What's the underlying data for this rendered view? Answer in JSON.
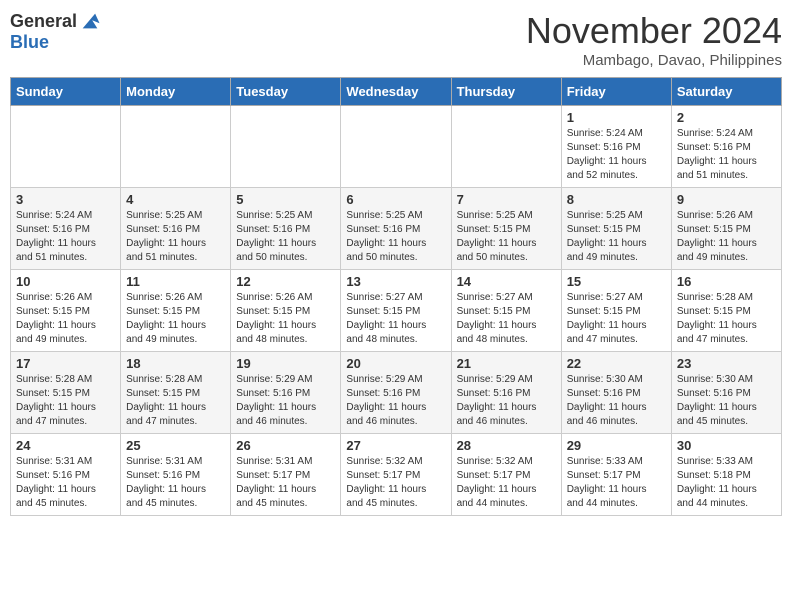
{
  "header": {
    "logo_general": "General",
    "logo_blue": "Blue",
    "month_title": "November 2024",
    "location": "Mambago, Davao, Philippines"
  },
  "weekdays": [
    "Sunday",
    "Monday",
    "Tuesday",
    "Wednesday",
    "Thursday",
    "Friday",
    "Saturday"
  ],
  "weeks": [
    {
      "days": [
        {
          "num": "",
          "info": ""
        },
        {
          "num": "",
          "info": ""
        },
        {
          "num": "",
          "info": ""
        },
        {
          "num": "",
          "info": ""
        },
        {
          "num": "",
          "info": ""
        },
        {
          "num": "1",
          "info": "Sunrise: 5:24 AM\nSunset: 5:16 PM\nDaylight: 11 hours\nand 52 minutes."
        },
        {
          "num": "2",
          "info": "Sunrise: 5:24 AM\nSunset: 5:16 PM\nDaylight: 11 hours\nand 51 minutes."
        }
      ]
    },
    {
      "days": [
        {
          "num": "3",
          "info": "Sunrise: 5:24 AM\nSunset: 5:16 PM\nDaylight: 11 hours\nand 51 minutes."
        },
        {
          "num": "4",
          "info": "Sunrise: 5:25 AM\nSunset: 5:16 PM\nDaylight: 11 hours\nand 51 minutes."
        },
        {
          "num": "5",
          "info": "Sunrise: 5:25 AM\nSunset: 5:16 PM\nDaylight: 11 hours\nand 50 minutes."
        },
        {
          "num": "6",
          "info": "Sunrise: 5:25 AM\nSunset: 5:16 PM\nDaylight: 11 hours\nand 50 minutes."
        },
        {
          "num": "7",
          "info": "Sunrise: 5:25 AM\nSunset: 5:15 PM\nDaylight: 11 hours\nand 50 minutes."
        },
        {
          "num": "8",
          "info": "Sunrise: 5:25 AM\nSunset: 5:15 PM\nDaylight: 11 hours\nand 49 minutes."
        },
        {
          "num": "9",
          "info": "Sunrise: 5:26 AM\nSunset: 5:15 PM\nDaylight: 11 hours\nand 49 minutes."
        }
      ]
    },
    {
      "days": [
        {
          "num": "10",
          "info": "Sunrise: 5:26 AM\nSunset: 5:15 PM\nDaylight: 11 hours\nand 49 minutes."
        },
        {
          "num": "11",
          "info": "Sunrise: 5:26 AM\nSunset: 5:15 PM\nDaylight: 11 hours\nand 49 minutes."
        },
        {
          "num": "12",
          "info": "Sunrise: 5:26 AM\nSunset: 5:15 PM\nDaylight: 11 hours\nand 48 minutes."
        },
        {
          "num": "13",
          "info": "Sunrise: 5:27 AM\nSunset: 5:15 PM\nDaylight: 11 hours\nand 48 minutes."
        },
        {
          "num": "14",
          "info": "Sunrise: 5:27 AM\nSunset: 5:15 PM\nDaylight: 11 hours\nand 48 minutes."
        },
        {
          "num": "15",
          "info": "Sunrise: 5:27 AM\nSunset: 5:15 PM\nDaylight: 11 hours\nand 47 minutes."
        },
        {
          "num": "16",
          "info": "Sunrise: 5:28 AM\nSunset: 5:15 PM\nDaylight: 11 hours\nand 47 minutes."
        }
      ]
    },
    {
      "days": [
        {
          "num": "17",
          "info": "Sunrise: 5:28 AM\nSunset: 5:15 PM\nDaylight: 11 hours\nand 47 minutes."
        },
        {
          "num": "18",
          "info": "Sunrise: 5:28 AM\nSunset: 5:15 PM\nDaylight: 11 hours\nand 47 minutes."
        },
        {
          "num": "19",
          "info": "Sunrise: 5:29 AM\nSunset: 5:16 PM\nDaylight: 11 hours\nand 46 minutes."
        },
        {
          "num": "20",
          "info": "Sunrise: 5:29 AM\nSunset: 5:16 PM\nDaylight: 11 hours\nand 46 minutes."
        },
        {
          "num": "21",
          "info": "Sunrise: 5:29 AM\nSunset: 5:16 PM\nDaylight: 11 hours\nand 46 minutes."
        },
        {
          "num": "22",
          "info": "Sunrise: 5:30 AM\nSunset: 5:16 PM\nDaylight: 11 hours\nand 46 minutes."
        },
        {
          "num": "23",
          "info": "Sunrise: 5:30 AM\nSunset: 5:16 PM\nDaylight: 11 hours\nand 45 minutes."
        }
      ]
    },
    {
      "days": [
        {
          "num": "24",
          "info": "Sunrise: 5:31 AM\nSunset: 5:16 PM\nDaylight: 11 hours\nand 45 minutes."
        },
        {
          "num": "25",
          "info": "Sunrise: 5:31 AM\nSunset: 5:16 PM\nDaylight: 11 hours\nand 45 minutes."
        },
        {
          "num": "26",
          "info": "Sunrise: 5:31 AM\nSunset: 5:17 PM\nDaylight: 11 hours\nand 45 minutes."
        },
        {
          "num": "27",
          "info": "Sunrise: 5:32 AM\nSunset: 5:17 PM\nDaylight: 11 hours\nand 45 minutes."
        },
        {
          "num": "28",
          "info": "Sunrise: 5:32 AM\nSunset: 5:17 PM\nDaylight: 11 hours\nand 44 minutes."
        },
        {
          "num": "29",
          "info": "Sunrise: 5:33 AM\nSunset: 5:17 PM\nDaylight: 11 hours\nand 44 minutes."
        },
        {
          "num": "30",
          "info": "Sunrise: 5:33 AM\nSunset: 5:18 PM\nDaylight: 11 hours\nand 44 minutes."
        }
      ]
    }
  ]
}
